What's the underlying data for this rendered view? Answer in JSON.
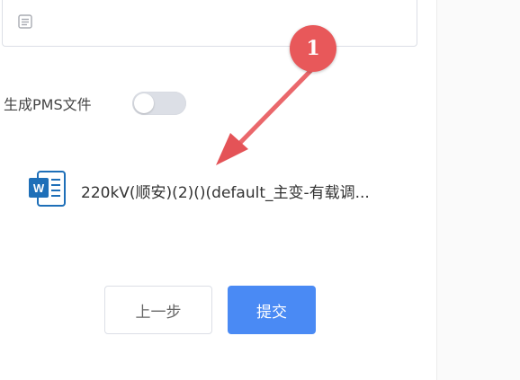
{
  "form": {
    "pms_label": "生成PMS文件",
    "pms_toggle_on": false
  },
  "file": {
    "name": "220kV(顺安)(2)()(default_主变-有载调...",
    "icon": "word-doc-icon",
    "icon_letter": "W"
  },
  "buttons": {
    "prev_label": "上一步",
    "submit_label": "提交"
  },
  "annotation": {
    "badge_number": "1"
  },
  "colors": {
    "primary": "#4a8af4",
    "badge": "#e8585a",
    "word_blue": "#1e6fb8",
    "toggle_off": "#dcdfe6"
  }
}
